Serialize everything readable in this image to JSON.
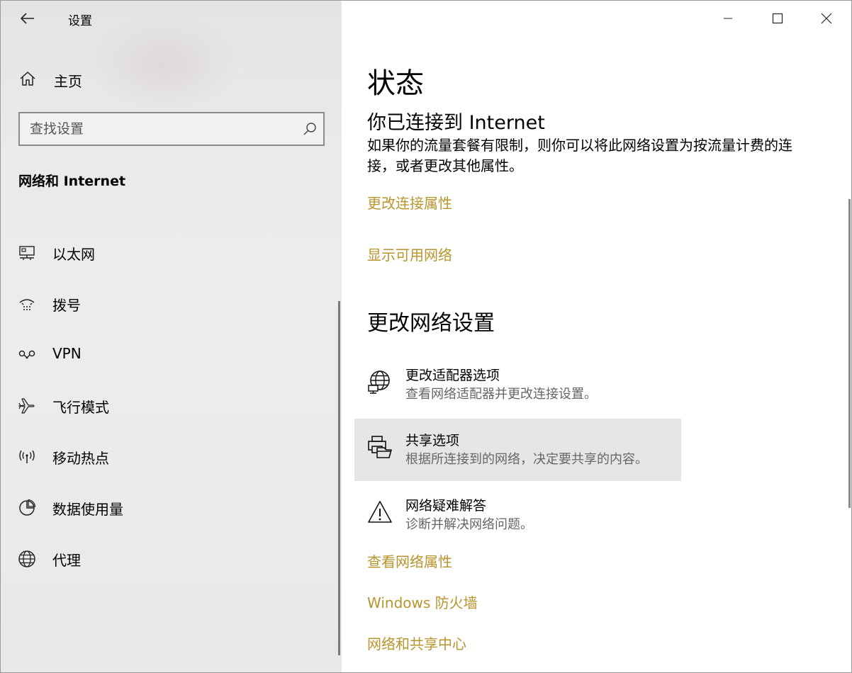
{
  "window": {
    "title": "设置",
    "accent_color": "#b8952c"
  },
  "sidebar": {
    "home_label": "主页",
    "search_placeholder": "查找设置",
    "section_title": "网络和 Internet",
    "items": [
      {
        "label": "以太网",
        "icon": "ethernet-icon"
      },
      {
        "label": "拨号",
        "icon": "dialup-icon"
      },
      {
        "label": "VPN",
        "icon": "vpn-icon"
      },
      {
        "label": "飞行模式",
        "icon": "airplane-icon"
      },
      {
        "label": "移动热点",
        "icon": "hotspot-icon"
      },
      {
        "label": "数据使用量",
        "icon": "data-usage-icon"
      },
      {
        "label": "代理",
        "icon": "globe-icon"
      }
    ]
  },
  "main": {
    "page_title": "状态",
    "connection_title": "你已连接到 Internet",
    "connection_desc": "如果你的流量套餐有限制，则你可以将此网络设置为按流量计费的连接，或者更改其他属性。",
    "links_top": [
      "更改连接属性",
      "显示可用网络"
    ],
    "change_section_title": "更改网络设置",
    "options": [
      {
        "title": "更改适配器选项",
        "desc": "查看网络适配器并更改连接设置。",
        "icon": "adapter-globe-icon"
      },
      {
        "title": "共享选项",
        "desc": "根据所连接到的网络，决定要共享的内容。",
        "icon": "sharing-printer-icon"
      },
      {
        "title": "网络疑难解答",
        "desc": "诊断并解决网络问题。",
        "icon": "warning-icon"
      }
    ],
    "links_bottom": [
      "查看网络属性",
      "Windows 防火墙",
      "网络和共享中心"
    ]
  }
}
